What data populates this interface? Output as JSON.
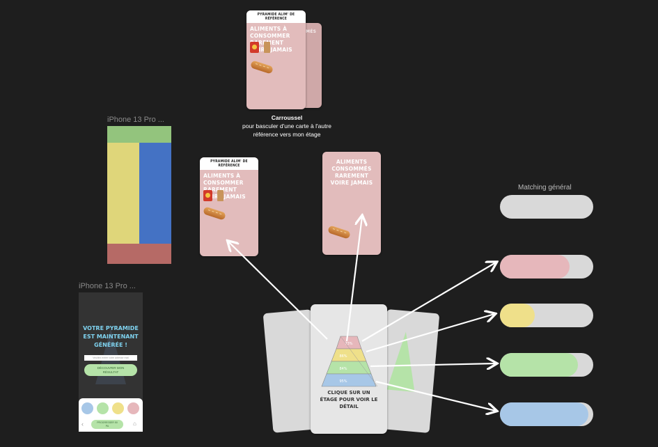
{
  "top_card": {
    "header": "PYRAMIDE ALIM' DE RÉFÉRENCE",
    "title": "ALIMENTS À CONSOMMER RAREMENT VOIRE JAMAIS",
    "behind_text": "MMÉS"
  },
  "carousel_caption": {
    "title": "Carroussel",
    "line1": "pour basculer d'une carte à l'autre",
    "line2": "référence vers mon étage"
  },
  "frames": {
    "frame1_label": "iPhone 13 Pro ...",
    "frame2_label": "iPhone 13 Pro ..."
  },
  "ref_card": {
    "header": "PYRAMIDE ALIM' DE RÉFÉRENCE",
    "title": "ALIMENTS À CONSOMMER RAREMENT VOIRE JAMAIS"
  },
  "consumed_card": {
    "title": "ALIMENTS CONSOMMÉS RAREMENT VOIRE JAMAIS"
  },
  "result_phone": {
    "headline": "VOTRE PYRAMIDE EST MAINTENANT GÉNÉRÉE !",
    "input_placeholder": "Veuillez entrer votre adresse mail",
    "button_label": "DÉCOUVRIR MON RÉSULTAT",
    "nav_button_label": "PROGRESSER 50 PA",
    "swatches": [
      "#a7c7e7",
      "#b5e3a8",
      "#efe08a",
      "#e6b7bb"
    ]
  },
  "pyramid_card": {
    "levels": [
      "73%",
      "86%",
      "84%",
      "95%"
    ],
    "caption": "CLIQUE SUR UN ÉTAGE POUR VOIR LE DÉTAIL"
  },
  "matching": {
    "title": "Matching général",
    "bars": [
      {
        "name": "general",
        "fill": 0,
        "color": "#d9d9d9"
      },
      {
        "name": "pink",
        "fill": 0.75,
        "color": "#e6b7bb"
      },
      {
        "name": "yellow",
        "fill": 0.38,
        "color": "#efe08a"
      },
      {
        "name": "green",
        "fill": 0.84,
        "color": "#b5e3a8"
      },
      {
        "name": "blue",
        "fill": 0.95,
        "color": "#a7c7e7"
      }
    ]
  }
}
